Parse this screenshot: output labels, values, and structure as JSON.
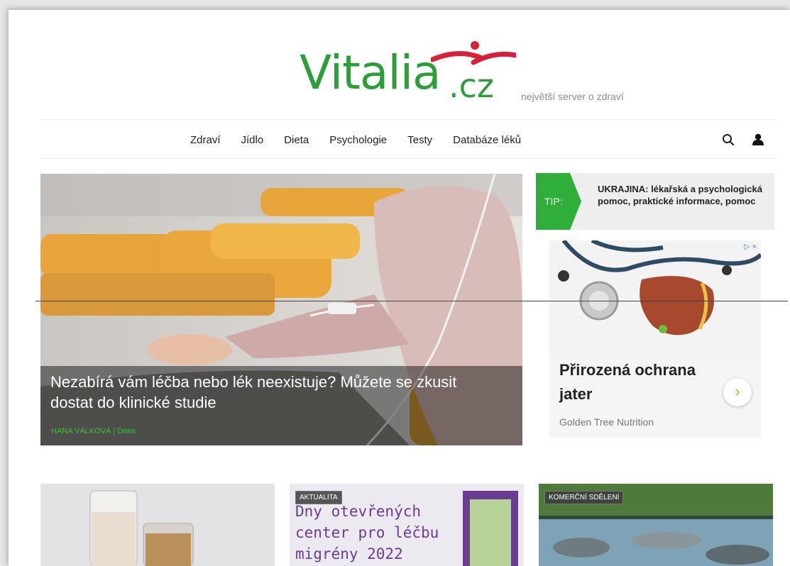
{
  "header": {
    "logo_text": "Vitalia",
    "logo_tld": ".cz",
    "tagline": "největší server o zdraví"
  },
  "nav": {
    "items": [
      {
        "label": "Zdraví"
      },
      {
        "label": "Jídlo"
      },
      {
        "label": "Dieta"
      },
      {
        "label": "Psychologie"
      },
      {
        "label": "Testy"
      },
      {
        "label": "Databáze léků"
      }
    ],
    "icons": [
      "search-icon",
      "user-icon"
    ]
  },
  "hero": {
    "title": "Nezabírá vám léčba nebo lék neexistuje? Můžete se zkusit dostat do klinické studie",
    "author": "HANA VÁLKOVÁ",
    "separator": "|",
    "date": "Dnes"
  },
  "tip": {
    "label": "TIP:",
    "text": "UKRAJINA: lékařská a psychologická pomoc, praktické informace, pomoc"
  },
  "ad": {
    "choice_icons": "▷ ×",
    "title": "Přirozená ochrana jater",
    "sponsor": "Golden Tree Nutrition",
    "arrow": "›"
  },
  "cards": [
    {
      "badge": "",
      "text": ""
    },
    {
      "badge": "AKTUALITA",
      "text": "Dny otevřených center pro léčbu migrény 2022"
    },
    {
      "badge": "KOMERČNÍ SDĚLENÍ",
      "text": ""
    }
  ],
  "colors": {
    "brand_green": "#2e9e3a",
    "brand_red": "#d6213a",
    "tip_green": "#2fae3c",
    "author_green": "#3fbf3f"
  }
}
